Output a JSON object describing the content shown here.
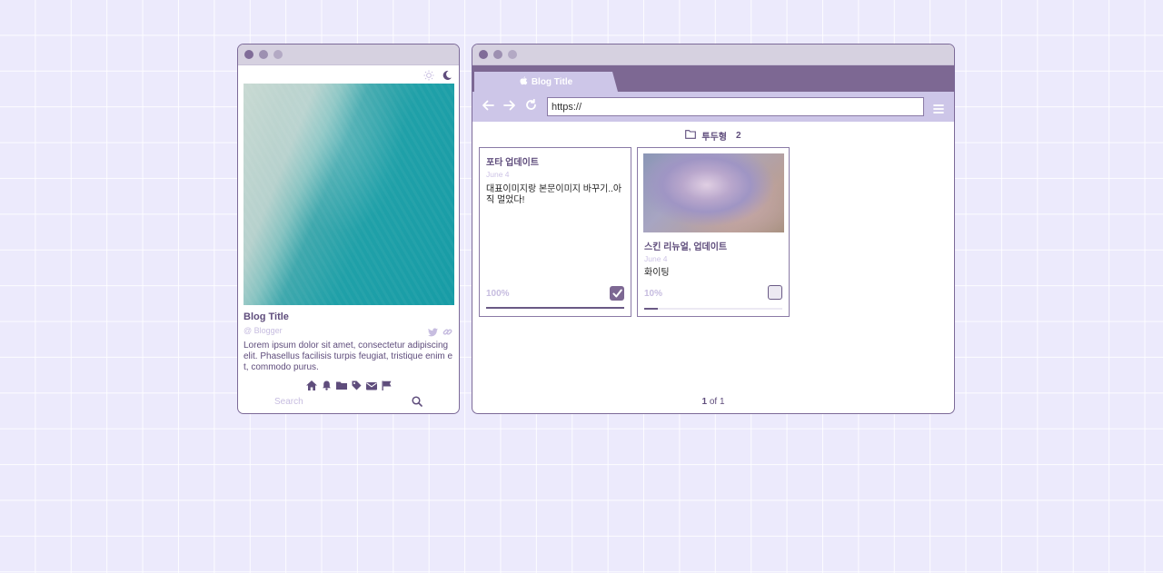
{
  "colors": {
    "accent": "#7d6893",
    "light_accent": "#cdc6e8",
    "text": "#5f4d7c",
    "muted": "#c7bde0",
    "background": "#eceafc"
  },
  "left_window": {
    "theme_icons": [
      "sun-icon",
      "moon-icon"
    ],
    "blog_title": "Blog Title",
    "blogger": "@ Blogger",
    "social_icons": [
      "twitter-icon",
      "link-icon"
    ],
    "description": "Lorem ipsum dolor sit amet, consectetur adipiscing elit. Phasellus facilisis turpis feugiat, tristique enim et, commodo purus.",
    "nav_icons": [
      "home-icon",
      "bell-icon",
      "folder-icon",
      "tag-icon",
      "mail-icon",
      "flag-icon"
    ],
    "search_placeholder": "Search"
  },
  "browser": {
    "tab_label": "Blog Title",
    "url": "https://",
    "category": {
      "name": "투두형",
      "count": "2"
    },
    "cards": [
      {
        "title": "포타 업데이트",
        "date": "June 4",
        "body": "대표이미지랑 본문이미지 바꾸기..아직 멀었다!",
        "percent_label": "100%",
        "progress": 1.0,
        "checked": true
      },
      {
        "title": "스킨 리뉴얼, 업데이트",
        "date": "June 4",
        "body": "화이팅",
        "percent_label": "10%",
        "progress": 0.1,
        "checked": false
      }
    ],
    "pagination": {
      "current": "1",
      "separator": "of",
      "total": "1"
    }
  }
}
